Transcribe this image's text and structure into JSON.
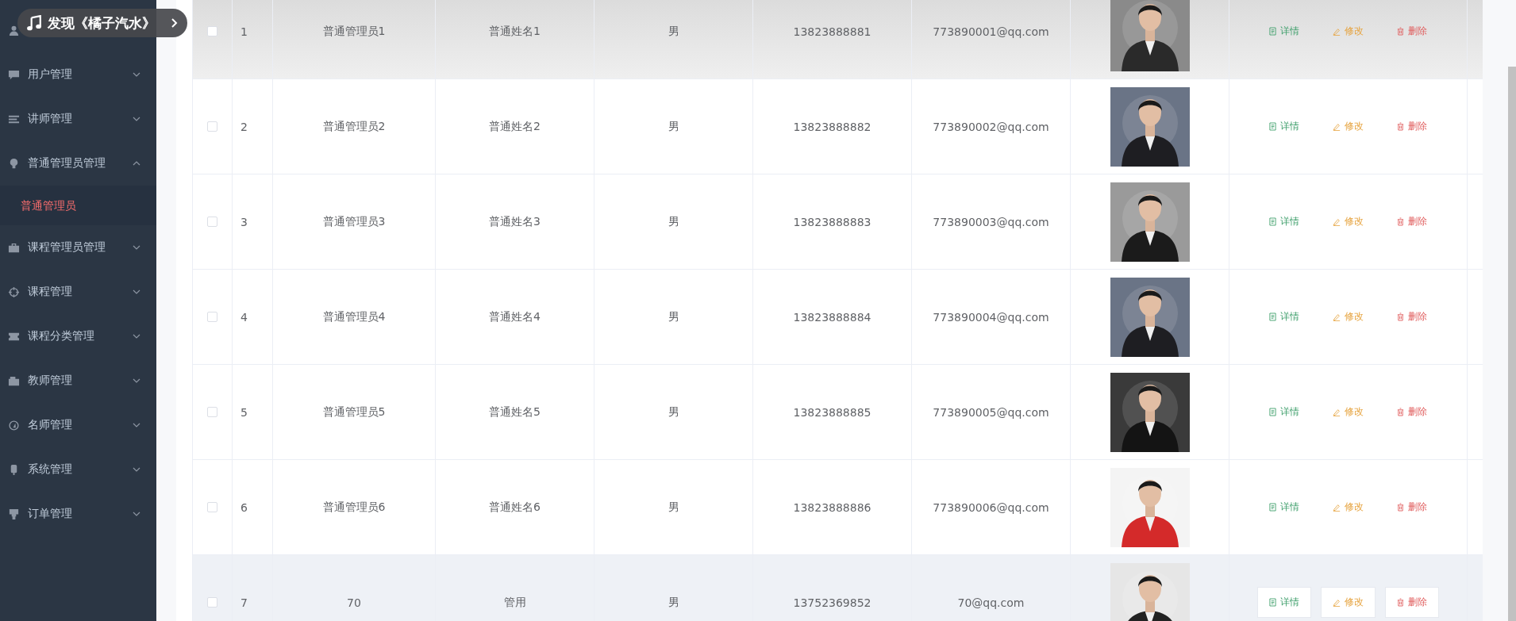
{
  "music_toast": {
    "text": "发现《橘子汽水》"
  },
  "sidebar": {
    "items": [
      {
        "label": "用户管理",
        "expanded": false
      },
      {
        "label": "讲师管理",
        "expanded": false
      },
      {
        "label": "普通管理员管理",
        "expanded": true,
        "children": [
          {
            "label": "普通管理员",
            "selected": true
          }
        ]
      },
      {
        "label": "课程管理员管理",
        "expanded": false
      },
      {
        "label": "课程管理",
        "expanded": false
      },
      {
        "label": "课程分类管理",
        "expanded": false
      },
      {
        "label": "教师管理",
        "expanded": false
      },
      {
        "label": "名师管理",
        "expanded": false
      },
      {
        "label": "系统管理",
        "expanded": false
      },
      {
        "label": "订单管理",
        "expanded": false
      }
    ]
  },
  "table": {
    "rows": [
      {
        "index": "1",
        "account": "普通管理员1",
        "name": "普通姓名1",
        "gender": "男",
        "phone": "13823888881",
        "email": "773890001@qq.com",
        "checked": false,
        "hovered": false,
        "actions": [
          "详情",
          "修改",
          "删除"
        ]
      },
      {
        "index": "2",
        "account": "普通管理员2",
        "name": "普通姓名2",
        "gender": "男",
        "phone": "13823888882",
        "email": "773890002@qq.com",
        "checked": false,
        "hovered": false,
        "actions": [
          "详情",
          "修改",
          "删除"
        ]
      },
      {
        "index": "3",
        "account": "普通管理员3",
        "name": "普通姓名3",
        "gender": "男",
        "phone": "13823888883",
        "email": "773890003@qq.com",
        "checked": false,
        "hovered": false,
        "actions": [
          "详情",
          "修改",
          "删除"
        ]
      },
      {
        "index": "4",
        "account": "普通管理员4",
        "name": "普通姓名4",
        "gender": "男",
        "phone": "13823888884",
        "email": "773890004@qq.com",
        "checked": false,
        "hovered": false,
        "actions": [
          "详情",
          "修改",
          "删除"
        ]
      },
      {
        "index": "5",
        "account": "普通管理员5",
        "name": "普通姓名5",
        "gender": "男",
        "phone": "13823888885",
        "email": "773890005@qq.com",
        "checked": false,
        "hovered": false,
        "actions": [
          "详情",
          "修改",
          "删除"
        ]
      },
      {
        "index": "6",
        "account": "普通管理员6",
        "name": "普通姓名6",
        "gender": "男",
        "phone": "13823888886",
        "email": "773890006@qq.com",
        "checked": false,
        "hovered": false,
        "actions": [
          "详情",
          "修改",
          "删除"
        ]
      },
      {
        "index": "7",
        "account": "70",
        "name": "管用",
        "gender": "男",
        "phone": "13752369852",
        "email": "70@qq.com",
        "checked": false,
        "hovered": true,
        "actions": [
          "详情",
          "修改",
          "删除"
        ]
      }
    ]
  }
}
